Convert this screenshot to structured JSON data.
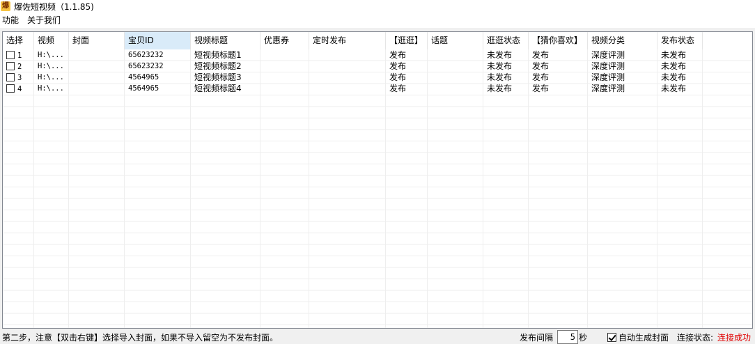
{
  "window": {
    "title": "爆佐短视频（1.1.85)",
    "icon_glyph": "爆",
    "icon_name": "app-logo-icon"
  },
  "menu": {
    "items": [
      "功能",
      "关于我们"
    ]
  },
  "grid": {
    "columns": [
      "选择",
      "视频",
      "封面",
      "宝贝ID",
      "视频标题",
      "优惠券",
      "定时发布",
      "【逛逛】",
      "话题",
      "逛逛状态",
      "【猜你喜欢】",
      "视频分类",
      "发布状态"
    ],
    "active_column": "宝贝ID",
    "rows": [
      {
        "select": "1",
        "video": "H:\\...",
        "cover": "",
        "item_id": "65623232",
        "title": "短视频标题1",
        "coupon": "",
        "schedule": "",
        "guangguang": "发布",
        "topic": "",
        "gg_status": "未发布",
        "guess_like": "发布",
        "category": "深度评测",
        "status": "未发布"
      },
      {
        "select": "2",
        "video": "H:\\...",
        "cover": "",
        "item_id": "65623232",
        "title": "短视频标题2",
        "coupon": "",
        "schedule": "",
        "guangguang": "发布",
        "topic": "",
        "gg_status": "未发布",
        "guess_like": "发布",
        "category": "深度评测",
        "status": "未发布"
      },
      {
        "select": "3",
        "video": "H:\\...",
        "cover": "",
        "item_id": "4564965",
        "title": "短视频标题3",
        "coupon": "",
        "schedule": "",
        "guangguang": "发布",
        "topic": "",
        "gg_status": "未发布",
        "guess_like": "发布",
        "category": "深度评测",
        "status": "未发布"
      },
      {
        "select": "4",
        "video": "H:\\...",
        "cover": "",
        "item_id": "4564965",
        "title": "短视频标题4",
        "coupon": "",
        "schedule": "",
        "guangguang": "发布",
        "topic": "",
        "gg_status": "未发布",
        "guess_like": "发布",
        "category": "深度评测",
        "status": "未发布"
      }
    ]
  },
  "status": {
    "hint": "第二步，注意【双击右键】选择导入封面，如果不导入留空为不发布封面。",
    "interval_label": "发布间隔",
    "interval_value": "5",
    "interval_unit": "秒",
    "auto_cover_label": "自动生成封面",
    "auto_cover_checked": true,
    "connection_label": "连接状态:",
    "connection_value": "连接成功",
    "connection_color": "#e00000"
  }
}
